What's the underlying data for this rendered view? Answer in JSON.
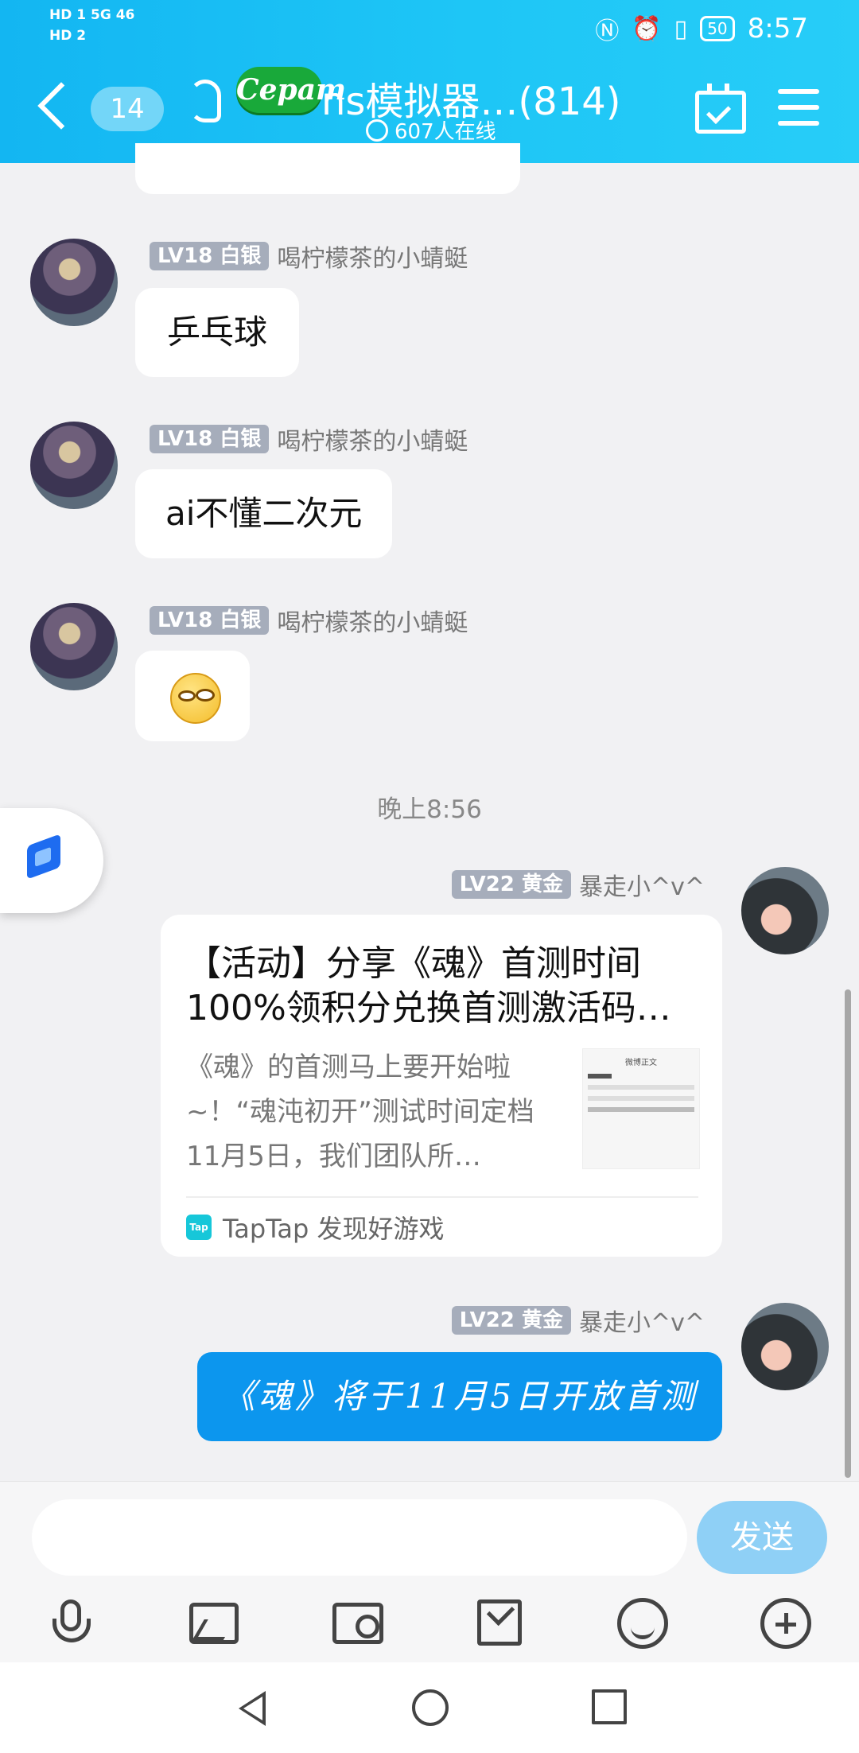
{
  "status_bar": {
    "left_line1": "HD 1  5G  46",
    "left_line2": "HD 2",
    "battery": "50",
    "time": "8:57"
  },
  "header": {
    "unread_count": "14",
    "group_title": "ns模拟器…(814)",
    "online_count": "607人在线",
    "logo_text": "Cepam"
  },
  "messages": [
    {
      "level": "LV18",
      "rank": "白银",
      "name": "喝柠檬茶的小蜻蜓",
      "text": "乒乓球"
    },
    {
      "level": "LV18",
      "rank": "白银",
      "name": "喝柠檬茶的小蜻蜓",
      "text": "ai不懂二次元"
    },
    {
      "level": "LV18",
      "rank": "白银",
      "name": "喝柠檬茶的小蜻蜓",
      "text": ""
    }
  ],
  "timestamp": "晚上8:56",
  "card_message": {
    "level": "LV22",
    "rank": "黄金",
    "name": "暴走小^v^",
    "title": "【活动】分享《魂》首测时间100%领积分兑换首测激活码…",
    "description": "《魂》的首测马上要开始啦~！“魂沌初开”测试时间定档11月5日，我们团队所…",
    "source": "TapTap 发现好游戏",
    "source_logo": "Tap",
    "thumb_header": "微博正文"
  },
  "last_message": {
    "level": "LV22",
    "rank": "黄金",
    "name": "暴走小^v^",
    "text": "《魂》将于11月5日开放首测"
  },
  "input": {
    "placeholder": "",
    "send_label": "发送"
  },
  "colors": {
    "header_start": "#13b6f2",
    "header_end": "#27cdf8",
    "send_button": "#8fd0f6",
    "blue_bubble": "#0c96ee"
  }
}
